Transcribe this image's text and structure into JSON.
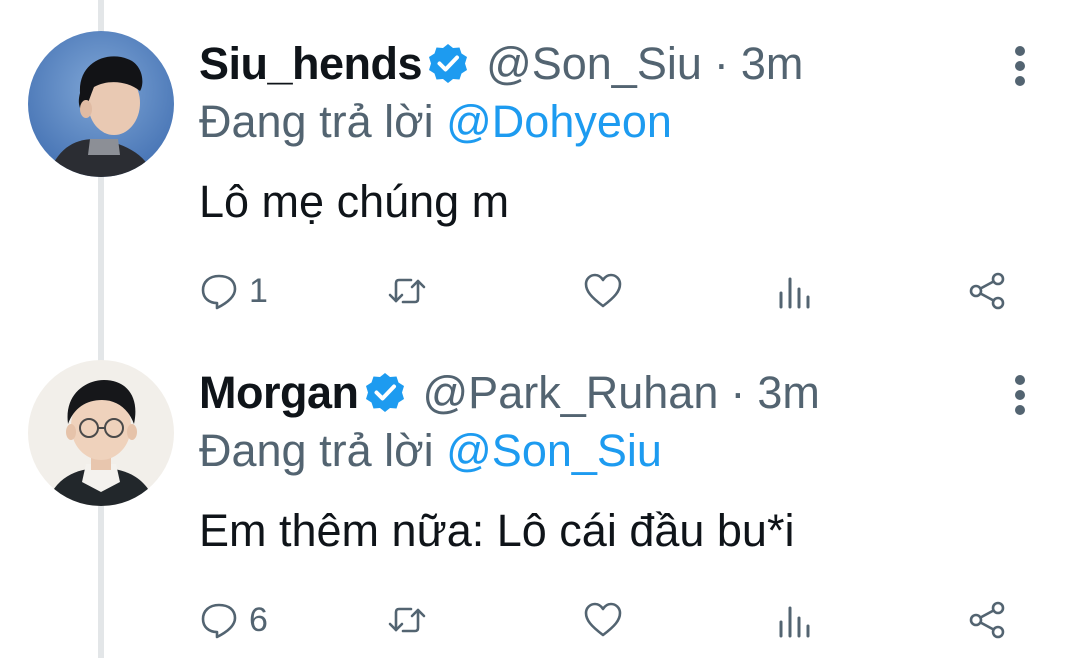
{
  "tweets": [
    {
      "display_name": "Siu_hends",
      "verified": true,
      "handle": "@Son_Siu",
      "separator": "·",
      "time": "3m",
      "replying_prefix": "Đang trả lời",
      "replying_to": "@Dohyeon",
      "text": "Lô mẹ chúng m",
      "reply_count": "1",
      "retweet_count": "",
      "like_count": "",
      "avatar": "avatar-photo-siu"
    },
    {
      "display_name": "Morgan",
      "verified": true,
      "handle": "@Park_Ruhan",
      "separator": "·",
      "time": "3m",
      "replying_prefix": "Đang trả lời",
      "replying_to": "@Son_Siu",
      "text": "Em thêm nữa: Lô cái đầu bu*i",
      "reply_count": "6",
      "retweet_count": "",
      "like_count": "",
      "avatar": "avatar-photo-morgan"
    }
  ],
  "icons": {
    "reply": "reply-icon",
    "retweet": "retweet-icon",
    "like": "heart-icon",
    "views": "views-icon",
    "share": "share-icon",
    "more": "more-options-icon",
    "verified": "verified-badge-icon"
  },
  "colors": {
    "verified_blue": "#1d9bf0",
    "mention_blue": "#1d9bf0",
    "secondary_text": "#536471",
    "primary_text": "#0f1419",
    "thread_line": "#e3e6e8"
  }
}
